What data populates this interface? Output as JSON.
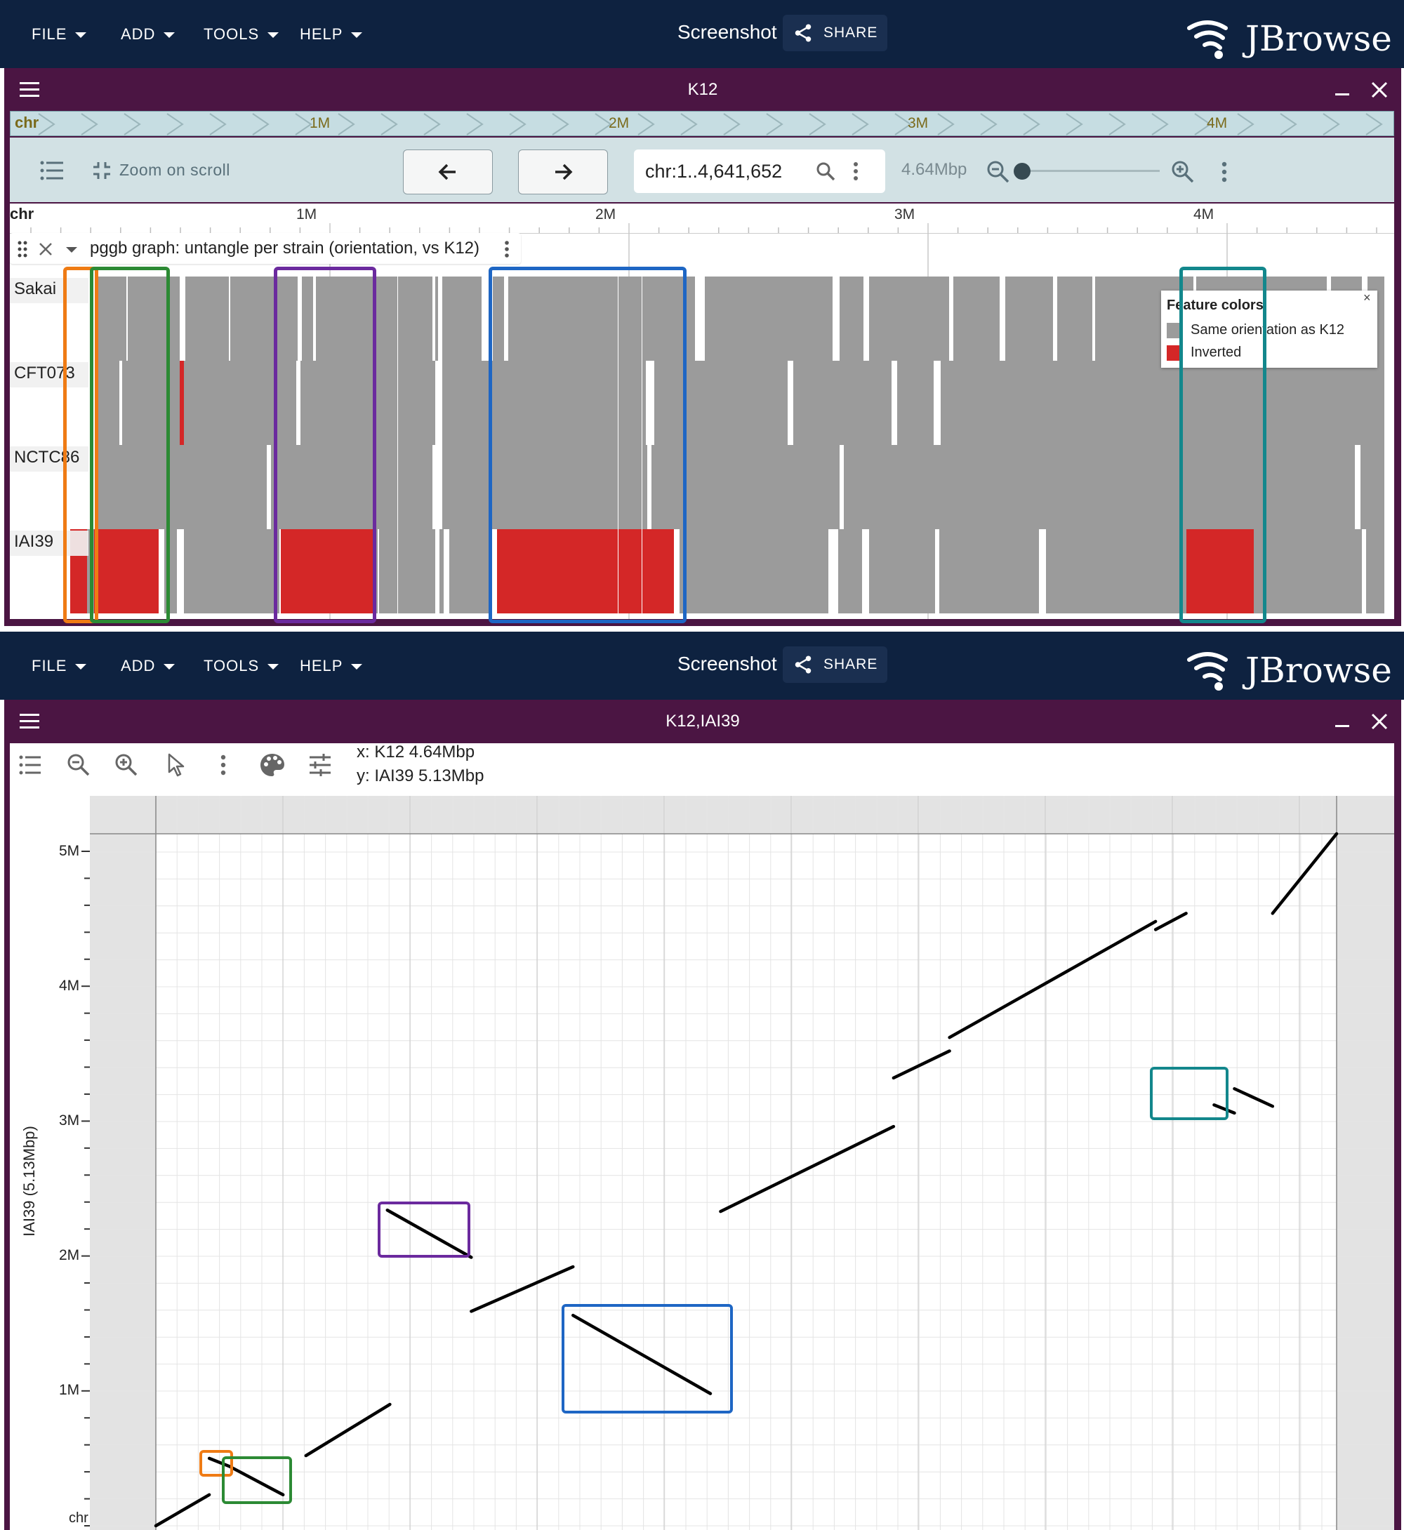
{
  "top_appbar": {
    "menus": [
      "FILE",
      "ADD",
      "TOOLS",
      "HELP"
    ],
    "screenshot_label": "Screenshot",
    "share_label": "SHARE",
    "brand": "JBrowse"
  },
  "linear_view": {
    "title": "K12",
    "overview": {
      "chrom": "chr",
      "ticks": [
        "1M",
        "2M",
        "3M",
        "4M"
      ]
    },
    "toolbar": {
      "zoom_on_scroll": "Zoom on scroll",
      "locstring": "chr:1..4,641,652",
      "span": "4.64Mbp",
      "zoom_level": 0.0
    },
    "ruler": {
      "chrom": "chr",
      "ticks": [
        "1M",
        "2M",
        "3M",
        "4M"
      ]
    },
    "track": {
      "name": "pggb graph: untangle per strain (orientation, vs K12)",
      "rows": [
        "Sakai",
        "CFT073",
        "NCTC86",
        "IAI39"
      ]
    },
    "legend": {
      "title": "Feature colors",
      "close": "×",
      "items": [
        {
          "label": "Same orientation as K12",
          "color": "#9b9b9b"
        },
        {
          "label": "Inverted",
          "color": "#d42727"
        }
      ]
    },
    "highlight_colors": [
      "#ef7b14",
      "#2c8a34",
      "#6b2a9e",
      "#1e66c4",
      "#13878c"
    ]
  },
  "bottom_appbar": {
    "menus": [
      "FILE",
      "ADD",
      "TOOLS",
      "HELP"
    ],
    "screenshot_label": "Screenshot",
    "share_label": "SHARE",
    "brand": "JBrowse"
  },
  "dotplot_view": {
    "title": "K12,IAI39",
    "x_info": "x: K12 4.64Mbp",
    "y_info": "y: IAI39 5.13Mbp",
    "y_axis_label": "IAI39 (5.13Mbp)",
    "y_ticks": [
      "5M",
      "4M",
      "3M",
      "2M",
      "1M"
    ],
    "y_origin_label": "chr"
  },
  "chart_data": {
    "type": "scatter",
    "title": "",
    "xlabel": "K12",
    "ylabel": "IAI39 (5.13Mbp)",
    "xlim": [
      0,
      4641652
    ],
    "ylim": [
      0,
      5130000
    ],
    "y_ticks": [
      1000000,
      2000000,
      3000000,
      4000000,
      5000000
    ],
    "series": [
      {
        "name": "",
        "segments": [
          {
            "x": [
              0,
              210000
            ],
            "y": [
              0,
              230000
            ]
          },
          {
            "x": [
              210000,
              290000
            ],
            "y": [
              500000,
              440000
            ]
          },
          {
            "x": [
              290000,
              500000
            ],
            "y": [
              440000,
              230000
            ]
          },
          {
            "x": [
              590000,
              920000
            ],
            "y": [
              520000,
              900000
            ]
          },
          {
            "x": [
              910000,
              1240000
            ],
            "y": [
              2340000,
              1990000
            ]
          },
          {
            "x": [
              1240000,
              1640000
            ],
            "y": [
              1590000,
              1920000
            ]
          },
          {
            "x": [
              1640000,
              2180000
            ],
            "y": [
              1560000,
              980000
            ]
          },
          {
            "x": [
              2220000,
              2900000
            ],
            "y": [
              2330000,
              2960000
            ]
          },
          {
            "x": [
              2900000,
              3120000
            ],
            "y": [
              3320000,
              3520000
            ]
          },
          {
            "x": [
              3120000,
              3930000
            ],
            "y": [
              3620000,
              4480000
            ]
          },
          {
            "x": [
              3930000,
              4050000
            ],
            "y": [
              4420000,
              4540000
            ]
          },
          {
            "x": [
              4160000,
              4240000
            ],
            "y": [
              3120000,
              3060000
            ]
          },
          {
            "x": [
              4240000,
              4390000
            ],
            "y": [
              3240000,
              3110000
            ]
          },
          {
            "x": [
              4390000,
              4641652
            ],
            "y": [
              4540000,
              5130000
            ]
          }
        ]
      }
    ]
  }
}
